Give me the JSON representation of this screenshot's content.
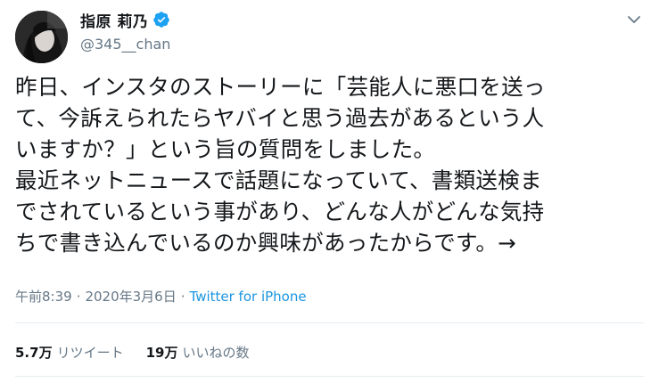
{
  "author": {
    "display_name": "指原 莉乃",
    "handle": "@345__chan",
    "verified": true
  },
  "tweet": {
    "text": "昨日、インスタのストーリーに「芸能人に悪口を送っ\nて、今訴えられたらヤバイと思う過去があるという人\nいますか？」という旨の質問をしました。\n最近ネットニュースで話題になっていて、書類送検ま\nでされているという事があり、どんな人がどんな気持\nちで書き込んでいるのか興味があったからです。→"
  },
  "meta": {
    "time": "午前8:39",
    "separator1": "·",
    "date": "2020年3月6日",
    "separator2": "·",
    "source": "Twitter for iPhone"
  },
  "stats": {
    "retweets_count": "5.7万",
    "retweets_label": "リツイート",
    "likes_count": "19万",
    "likes_label": "いいねの数"
  },
  "colors": {
    "accent": "#1da1f2",
    "link": "#1b95e0",
    "secondary_text": "#657786",
    "primary_text": "#14171a",
    "divider": "#e6ecf0"
  },
  "icons": {
    "verified": "verified-badge-icon",
    "menu": "chevron-down-icon"
  }
}
